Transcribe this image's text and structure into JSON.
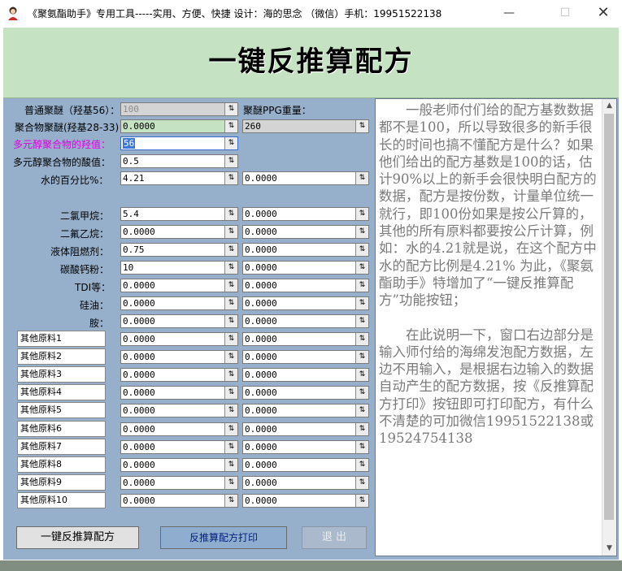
{
  "window": {
    "title": "《聚氨酯助手》专用工具-----实用、方便、快捷   设计：海的思念     （微信）手机：19951522138",
    "minimize": "—",
    "maximize": "☐",
    "close": "✕"
  },
  "header": {
    "title": "一键反推算配方"
  },
  "form": {
    "top_rows": [
      {
        "label": "普通聚醚（羟基56）：",
        "value": "100",
        "right_label": "聚醚PPG重量："
      },
      {
        "label": "聚合物聚醚(羟基28-33)：",
        "value": "0.0000",
        "right_value": "260"
      },
      {
        "label": "多元醇聚合物的羟值：",
        "value": "56"
      },
      {
        "label": "多元醇聚合物的酸值：",
        "value": "0.5"
      },
      {
        "label": "水的百分比%：",
        "value": "4.21",
        "right_value": "0.0000"
      }
    ],
    "material_rows": [
      {
        "label": "二氯甲烷：",
        "value": "5.4",
        "right_value": "0.0000"
      },
      {
        "label": "二氟乙烷：",
        "value": "0.0000",
        "right_value": "0.0000"
      },
      {
        "label": "液体阻燃剂：",
        "value": "0.75",
        "right_value": "0.0000"
      },
      {
        "label": "碳酸钙粉：",
        "value": "10",
        "right_value": "0.0000"
      },
      {
        "label": "TDI等：",
        "value": "0.0000",
        "right_value": "0.0000"
      },
      {
        "label": "硅油：",
        "value": "0.0000",
        "right_value": "0.0000"
      },
      {
        "label": "胺：",
        "value": "0.0000",
        "right_value": "0.0000"
      }
    ],
    "other_rows": [
      {
        "name": "其他原料1",
        "value": "0.0000",
        "right_value": "0.0000"
      },
      {
        "name": "其他原料2",
        "value": "0.0000",
        "right_value": "0.0000"
      },
      {
        "name": "其他原料3",
        "value": "0.0000",
        "right_value": "0.0000"
      },
      {
        "name": "其他原料4",
        "value": "0.0000",
        "right_value": "0.0000"
      },
      {
        "name": "其他原料5",
        "value": "0.0000",
        "right_value": "0.0000"
      },
      {
        "name": "其他原料6",
        "value": "0.0000",
        "right_value": "0.0000"
      },
      {
        "name": "其他原料7",
        "value": "0.0000",
        "right_value": "0.0000"
      },
      {
        "name": "其他原料8",
        "value": "0.0000",
        "right_value": "0.0000"
      },
      {
        "name": "其他原料9",
        "value": "0.0000",
        "right_value": "0.0000"
      },
      {
        "name": "其他原料10",
        "value": "0.0000",
        "right_value": "0.0000"
      }
    ]
  },
  "buttons": {
    "calculate": "一键反推算配方",
    "print": "反推算配方打印",
    "exit": "退  出"
  },
  "info_text": {
    "paragraph1": "一般老师付们给的配方基数数据都不是100，所以导致很多的新手很长的时间也搞不懂配方是什么？如果他们给出的配方基数是100的话，估计90%以上的新手会很快明白配方的数据，配方是按份数，计量单位统一就行，即100份如果是按公斤算的，其他的所有原料都要按公斤计算，例如：水的4.21就是说，在这个配方中水的配方比例是4.21%  为此，《聚氨酯助手》特增加了“一键反推算配方”功能按钮；",
    "paragraph2": "在此说明一下，窗口右边部分是输入师付给的海绵发泡配方数据，左边不用输入，是根据右边输入的数据自动产生的配方数据，按《反推算配方打印》按钮即可打印配方，有什么不清楚的可加微信19951522138或19524754138"
  },
  "icons": {
    "spin": "spin-arrows-icon",
    "app": "user-avatar-icon",
    "scroll_up": "scroll-up-icon",
    "scroll_down": "scroll-down-icon"
  },
  "colors": {
    "panel": "#96b0cc",
    "header": "#c5e3c2",
    "label_highlight": "#e000e0",
    "print_button": "#8fadcf"
  }
}
